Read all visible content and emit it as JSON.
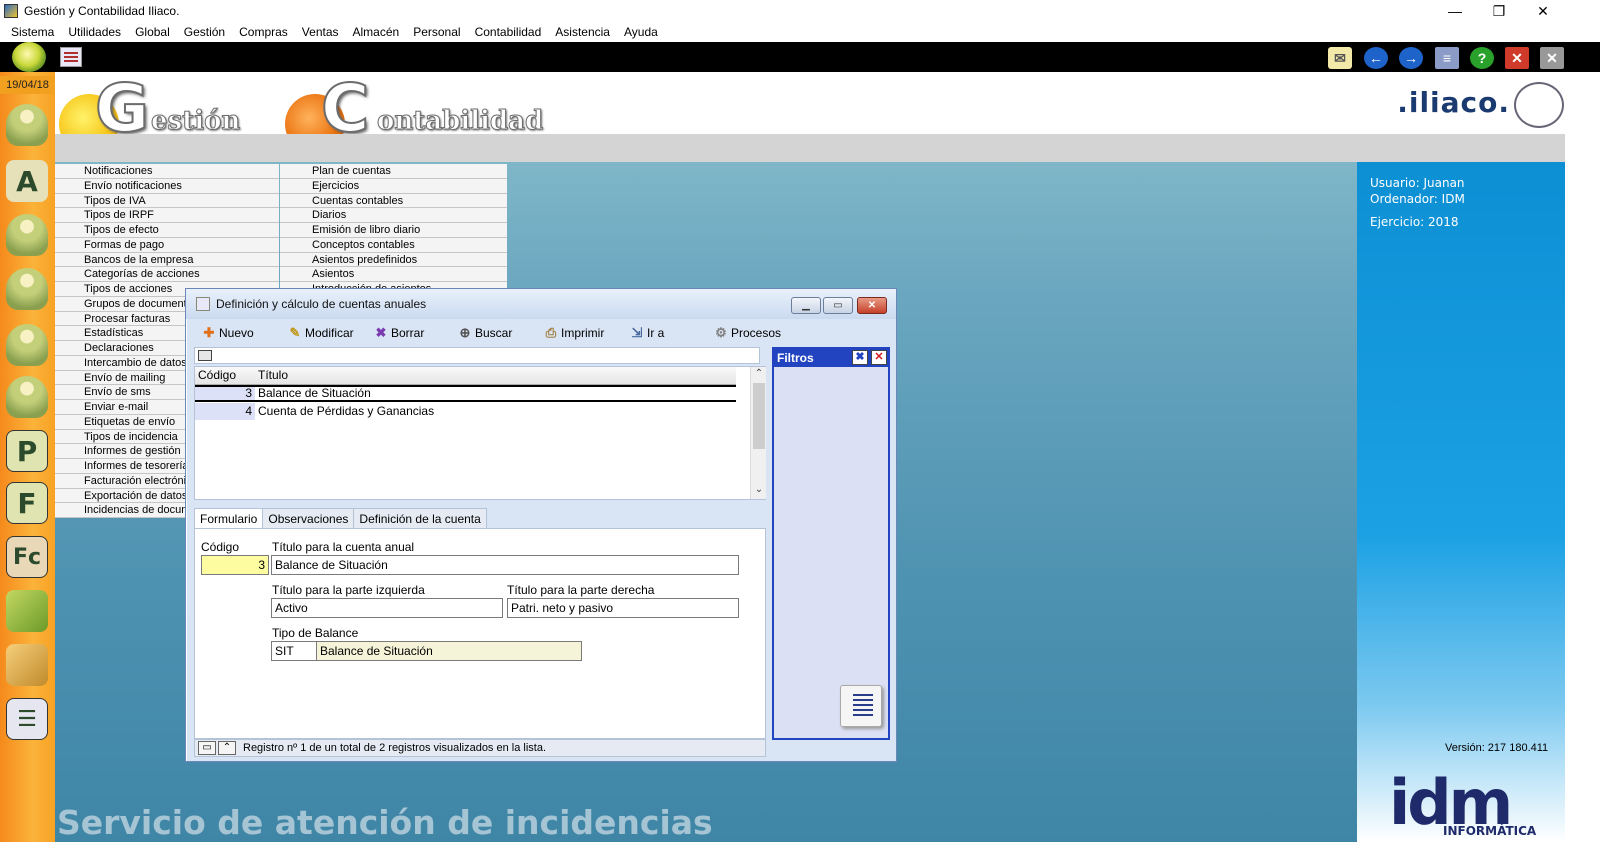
{
  "window": {
    "title": "Gestión y Contabilidad Iliaco.",
    "minimize": "—",
    "maximize": "❐",
    "close": "✕"
  },
  "menu": [
    "Sistema",
    "Utilidades",
    "Global",
    "Gestión",
    "Compras",
    "Ventas",
    "Almacén",
    "Personal",
    "Contabilidad",
    "Asistencia",
    "Ayuda"
  ],
  "sidebar": {
    "date": "19/04/18",
    "icons": [
      "users-icon",
      "abc-icon",
      "person-icon",
      "person-p-icon",
      "people-icon",
      "person-a-icon",
      "p-icon",
      "f-icon",
      "fc-icon",
      "bag-green-icon",
      "bag-orange-icon",
      "list-icon"
    ]
  },
  "header": {
    "gestion_letter": "G",
    "gestion_rest": "estión",
    "contab_letter": "C",
    "contab_rest": "ontabilidad",
    "brand": ".iliaco."
  },
  "menu_col1": [
    "Notificaciones",
    "Envío notificaciones",
    "Tipos de IVA",
    "Tipos de IRPF",
    "Tipos de efecto",
    "Formas de pago",
    "Bancos de la empresa",
    "Categorías de acciones",
    "Tipos de acciones",
    "Grupos de documentos",
    "Procesar facturas",
    "Estadísticas",
    "Declaraciones",
    "Intercambio de datos",
    "Envío de mailing",
    "Envío de sms",
    "Enviar e-mail",
    "Etiquetas de envío",
    "Tipos de incidencia",
    "Informes de gestión",
    "Informes de tesorería",
    "Facturación electrónica",
    "Exportación de datos",
    "Incidencias de documentos"
  ],
  "menu_col2": [
    "Plan de cuentas",
    "Ejercicios",
    "Cuentas contables",
    "Diarios",
    "Emisión de libro diario",
    "Conceptos contables",
    "Asientos predefinidos",
    "Asientos",
    "Introducción de asientos"
  ],
  "info": {
    "usuario": "Usuario: Juanan",
    "ordenador": "Ordenador: IDM",
    "ejercicio": "Ejercicio: 2018",
    "version": "Versión: 217 180.411",
    "idm": "idm",
    "idm_sub": "INFORMÁTICA"
  },
  "service_banner": "Servicio de atención de incidencias",
  "dialog": {
    "title": "Definición y cálculo de cuentas anuales",
    "toolbar": [
      "Nuevo",
      "Modificar",
      "Borrar",
      "Buscar",
      "Imprimir",
      "Ir a",
      "Procesos"
    ],
    "grid": {
      "headers": [
        "Código",
        "Título"
      ],
      "rows": [
        {
          "codigo": "3",
          "titulo": "Balance de Situación"
        },
        {
          "codigo": "4",
          "titulo": "Cuenta de Pérdidas y Ganancias"
        }
      ]
    },
    "filtros": "Filtros",
    "tabs": [
      "Formulario",
      "Observaciones",
      "Definición de la cuenta"
    ],
    "form": {
      "codigo_label": "Código",
      "codigo_value": "3",
      "titulo_label": "Título para la cuenta anual",
      "titulo_value": "Balance de Situación",
      "izq_label": "Título para la parte izquierda",
      "izq_value": "Activo",
      "der_label": "Título para la parte derecha",
      "der_value": "Patri. neto y pasivo",
      "tipo_label": "Tipo de Balance",
      "tipo_code": "SIT",
      "tipo_value": "Balance de Situación"
    },
    "status": "Registro nº 1 de un total de 2 registros visualizados en la lista."
  },
  "colors": {
    "sidebar_orange": "#f58a1c",
    "desktop_blue": "#4f93b2",
    "info_blue": "#0d8fd4",
    "filter_blue": "#2244c0"
  }
}
